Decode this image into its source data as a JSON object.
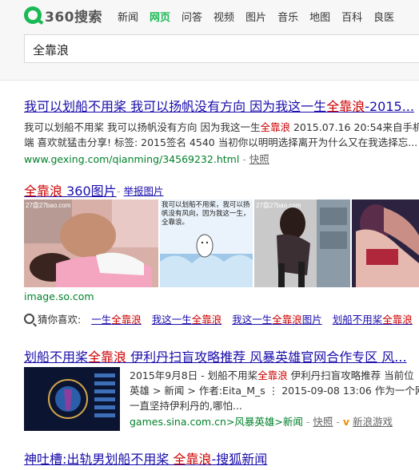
{
  "brand": {
    "logo_text": "360搜索"
  },
  "nav": [
    "新闻",
    "网页",
    "问答",
    "视频",
    "图片",
    "音乐",
    "地图",
    "百科",
    "良医"
  ],
  "nav_active": "网页",
  "search": {
    "query": "全靠浪"
  },
  "results": [
    {
      "title_a": "我可以划船不用桨 我可以扬帆没有方向 因为我这一生",
      "title_hl": "全靠浪",
      "title_b": "-2015...",
      "snippet1_a": "我可以划船不用桨 我可以扬帆没有方向 因为我这一生",
      "snippet1_hl": "全靠浪",
      "snippet1_b": " 2015.07.16 20:54来自手机",
      "snippet2": "端 喜欢就猛击分享! 标签: 2015签名 4540 当初你以明明选择离开为什么又在我选择忘...",
      "url": "www.gexing.com/qianming/34569232.html",
      "sep": " - ",
      "kuaizhao": "快照"
    },
    {
      "title_hl": "全靠浪",
      "title_b": " 360图片",
      "sep": " - ",
      "report": "举报图片",
      "img_caption": "我可以划船不用桨，我可以扬帆没有风向，因为我这一生，全靠浪。",
      "watermark": "27盘27bao.com",
      "url": "image.so.com"
    }
  ],
  "guess": {
    "label": "猜你喜欢:",
    "items": [
      {
        "pre": "一生",
        "hl": "全靠浪",
        "post": ""
      },
      {
        "pre": "我这一生",
        "hl": "全靠浪",
        "post": ""
      },
      {
        "pre": "我这一生",
        "hl": "全靠浪",
        "post": "图片"
      },
      {
        "pre": "划船不用桨",
        "hl": "全靠浪",
        "post": ""
      }
    ]
  },
  "result3": {
    "title_a": "划船不用桨",
    "title_hl": "全靠浪",
    "title_b": " 伊利丹扫盲攻略推荐 风暴英雄官网合作专区 风...",
    "line1_a": "2015年9月8日 - 划船不用桨",
    "line1_hl": "全靠浪",
    "line1_b": " 伊利丹扫盲攻略推荐 当前位",
    "line2": "英雄 > 新闻 > 作者:Eita_M_s ⋮ 2015-09-08 13:06 作为一个刚入",
    "line3": "一直坚持伊利丹的,哪怕...",
    "url": "games.sina.com.cn>风暴英雄>新闻",
    "sep": " - ",
    "kuaizhao": "快照",
    "v": "v",
    "source": "新浪游戏"
  },
  "result4": {
    "title_a": "神吐槽:出轨男划船不用桨 ",
    "title_hl": "全靠浪",
    "title_b": "-搜狐新闻"
  },
  "colors": {
    "brand_green": "#19b955",
    "link": "#1a0dab",
    "highlight": "#cc0000",
    "url_green": "#00802a"
  }
}
